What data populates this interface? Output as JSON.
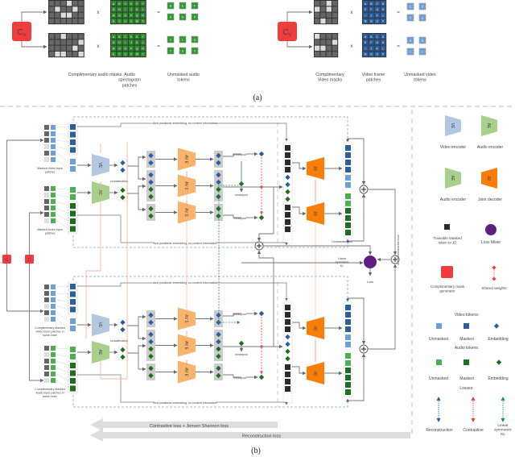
{
  "panel_a": {
    "caption": "(a)",
    "audio": {
      "generator_label": "C",
      "generator_sub": "A",
      "multiply": "x",
      "equals": "=",
      "patch_letters": [
        "A",
        "B",
        "C",
        "D",
        "E",
        "F",
        "G",
        "H",
        "I",
        "J",
        "K",
        "L",
        "M",
        "N",
        "O",
        "P",
        "Q",
        "R",
        "S",
        "T",
        "U",
        "V",
        "W",
        "X"
      ],
      "unmasked_top": [
        "B",
        "E",
        "F",
        "N",
        "O",
        "P"
      ],
      "unmasked_bottom": [
        "C",
        "L",
        "Q",
        "T",
        "U",
        "X"
      ],
      "mask_top": [
        0,
        0,
        0,
        1,
        0,
        0,
        0,
        1,
        0,
        0,
        1,
        0,
        0,
        0,
        1,
        1,
        0,
        0,
        0,
        0,
        0,
        0,
        0,
        0
      ],
      "mask_bottom": [
        0,
        0,
        1,
        0,
        0,
        0,
        0,
        0,
        0,
        0,
        0,
        1,
        0,
        0,
        0,
        0,
        1,
        0,
        0,
        1,
        1,
        0,
        0,
        1
      ],
      "labels": {
        "masks": "Complimentary audio masks",
        "patches": "Audio spectogram patches",
        "tokens": "Unmasked audio tokens"
      }
    },
    "video": {
      "generator_label": "C",
      "generator_sub": "V",
      "multiply": "x",
      "equals": "=",
      "patch_letters": [
        "A",
        "B",
        "C",
        "D",
        "E",
        "F",
        "G",
        "H",
        "I",
        "J",
        "K",
        "L",
        "M",
        "N",
        "O",
        "P"
      ],
      "unmasked_top": [
        "C",
        "D",
        "F",
        "K"
      ],
      "unmasked_bottom": [
        "A",
        "H",
        "I",
        "J"
      ],
      "mask_top": [
        0,
        0,
        1,
        0,
        1,
        0,
        1,
        0,
        0,
        0,
        0,
        0,
        0,
        1,
        0,
        0
      ],
      "mask_bottom": [
        1,
        0,
        0,
        0,
        0,
        0,
        0,
        1,
        1,
        1,
        0,
        0,
        0,
        0,
        0,
        0
      ],
      "labels": {
        "masks": "Complimentary Video masks",
        "patches": "Video frame patches",
        "tokens": "Unmasked video tokens"
      }
    }
  },
  "panel_b": {
    "caption": "(b)",
    "generators": [
      "C",
      "C"
    ],
    "input_labels": {
      "top_video": "Masked Video input patches",
      "top_audio": "Masked Audio input patches",
      "bottom_video": "Complimentary Masked Video input patches in same order",
      "bottom_audio": "Complimentary Masked Audio input patches in same order"
    },
    "encoder_labels": {
      "video": "VE",
      "audio": "AE",
      "joint_encoder": "AV E",
      "decoder": "JD"
    },
    "concatenation": "concatenation",
    "positional_note": "Just positional embedding, no content information",
    "meanpool": "meanpool",
    "contrastive_loss": "Contrastive loss",
    "linear_kl": "Linear Symmetric KL",
    "loss": "Loss",
    "av_reconstruction": "A-V Reconstruction loss",
    "bottom_arrows": {
      "contrastive": "Contrastive loss + Jensen Shannon loss",
      "reconstruction": "Reconstruction loss"
    }
  },
  "legend": {
    "video_encoder": "Video encoder",
    "audio_encoder_1": "Audio encoder",
    "audio_encoder_2": "Audio encoder",
    "joint_decoder": "Joint decoder",
    "trainable_token": "Trainable Masked token to JD",
    "loss_mixer": "Loss Mixer",
    "mask_generator": "Complimentary mask generator",
    "shared_weights": "Shared weights",
    "video_tokens_title": "Video tokens:",
    "audio_tokens_title": "Audio tokens:",
    "token_kinds": [
      "Unmasked",
      "Masked",
      "Embedding"
    ],
    "losses_title": "Losses:",
    "loss_kinds": [
      "Reconstruction",
      "Contrastive",
      "Linear symmetric KL"
    ]
  },
  "colors": {
    "mask_red": "#f03c3c",
    "video_light": "#6f9fd8",
    "video_dark": "#2c5f9e",
    "audio_light": "#4cb050",
    "audio_dark": "#1e6e22",
    "encoder_video": "#b3c7e0",
    "encoder_audio": "#a8d08d",
    "joint_encoder": "#f9b36b",
    "decoder": "#fa7d0a",
    "loss_mixer": "#5e1e82",
    "token_black": "#2b2b2b",
    "kl_green": "#1f8a6e"
  }
}
